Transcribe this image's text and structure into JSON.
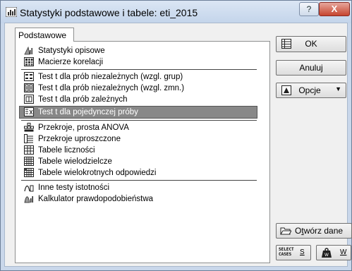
{
  "window": {
    "title": "Statystyki podstawowe i tabele: eti_2015",
    "help_symbol": "?",
    "close_symbol": "X"
  },
  "tabs": [
    {
      "label": "Podstawowe",
      "active": true
    }
  ],
  "list": {
    "items": [
      {
        "label": "Statystyki opisowe",
        "icon": "descriptive-stats-icon"
      },
      {
        "label": "Macierze korelacji",
        "icon": "correlation-matrix-icon"
      },
      {
        "label": "Test t dla prób niezależnych (wzgl. grup)",
        "icon": "t-test-groups-icon"
      },
      {
        "label": "Test t dla prób niezależnych (wzgl. zmn.)",
        "icon": "t-test-variables-icon"
      },
      {
        "label": "Test t dla prób zależnych",
        "icon": "t-test-dependent-icon"
      },
      {
        "label": "Test t dla pojedynczej próby",
        "icon": "t-test-single-icon",
        "selected": true
      },
      {
        "label": "Przekroje, prosta ANOVA",
        "icon": "breakdown-anova-icon"
      },
      {
        "label": "Przekroje uproszczone",
        "icon": "simple-breakdown-icon"
      },
      {
        "label": "Tabele liczności",
        "icon": "frequency-table-icon"
      },
      {
        "label": "Tabele wielodzielcze",
        "icon": "crosstab-icon"
      },
      {
        "label": "Tabele wielokrotnych odpowiedzi",
        "icon": "multiple-response-icon"
      },
      {
        "label": "Inne testy istotności",
        "icon": "other-tests-icon"
      },
      {
        "label": "Kalkulator prawdopodobieństwa",
        "icon": "probability-calculator-icon"
      }
    ]
  },
  "buttons": {
    "ok": "OK",
    "cancel": "Anuluj",
    "options": "Opcje",
    "open_data_prefix": "O",
    "open_data_accel": "t",
    "open_data_suffix": "wórz dane",
    "select_cases_line1": "SELECT",
    "select_cases_line2": "CASES",
    "select_cases_key": "S",
    "weights_key": "W"
  },
  "colors": {
    "selection": "#888888",
    "titlebar": "#c9d7ea",
    "close_button": "#c6452f"
  }
}
